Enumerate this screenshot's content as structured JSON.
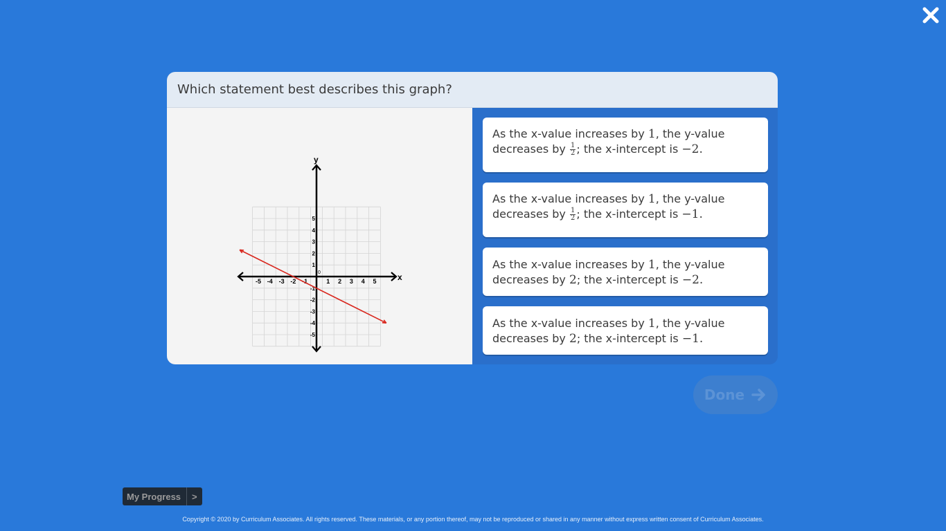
{
  "question": "Which statement best describes this graph?",
  "graph": {
    "x_label": "x",
    "y_label": "y",
    "x_ticks": [
      "-5",
      "-4",
      "-3",
      "-2",
      "-1",
      "1",
      "2",
      "3",
      "4",
      "5"
    ],
    "y_ticks": [
      "5",
      "4",
      "3",
      "2",
      "1",
      "-1",
      "-2",
      "-3",
      "-4",
      "-5"
    ],
    "origin_label": "0",
    "line_color": "#d9281f"
  },
  "answers": [
    {
      "p1": "As the x-value increases by ",
      "v1": "1",
      "p2": ", the y-value decreases by ",
      "num": "1",
      "den": "2",
      "p3": "; the x-intercept is ",
      "v3": "−2",
      "p4": "."
    },
    {
      "p1": "As the x-value increases by ",
      "v1": "1",
      "p2": ", the y-value decreases by ",
      "num": "1",
      "den": "2",
      "p3": "; the x-intercept is ",
      "v3": "−1",
      "p4": "."
    },
    {
      "p1": "As the x-value increases by ",
      "v1": "1",
      "p2": ", the y-value decreases by ",
      "v2": "2",
      "p3": "; the x-intercept is ",
      "v3": "−2",
      "p4": "."
    },
    {
      "p1": "As the x-value increases by ",
      "v1": "1",
      "p2": ", the y-value decreases by ",
      "v2": "2",
      "p3": "; the x-intercept is ",
      "v3": "−1",
      "p4": "."
    }
  ],
  "done_label": "Done",
  "progress_label": "My Progress",
  "progress_chevron": ">",
  "copyright": "Copyright © 2020 by Curriculum Associates. All rights reserved. These materials, or any portion thereof, may not be reproduced or shared in any manner without express written consent of Curriculum Associates.",
  "colors": {
    "background": "#2979da",
    "header": "#e3ebf4",
    "line": "#d9281f"
  }
}
